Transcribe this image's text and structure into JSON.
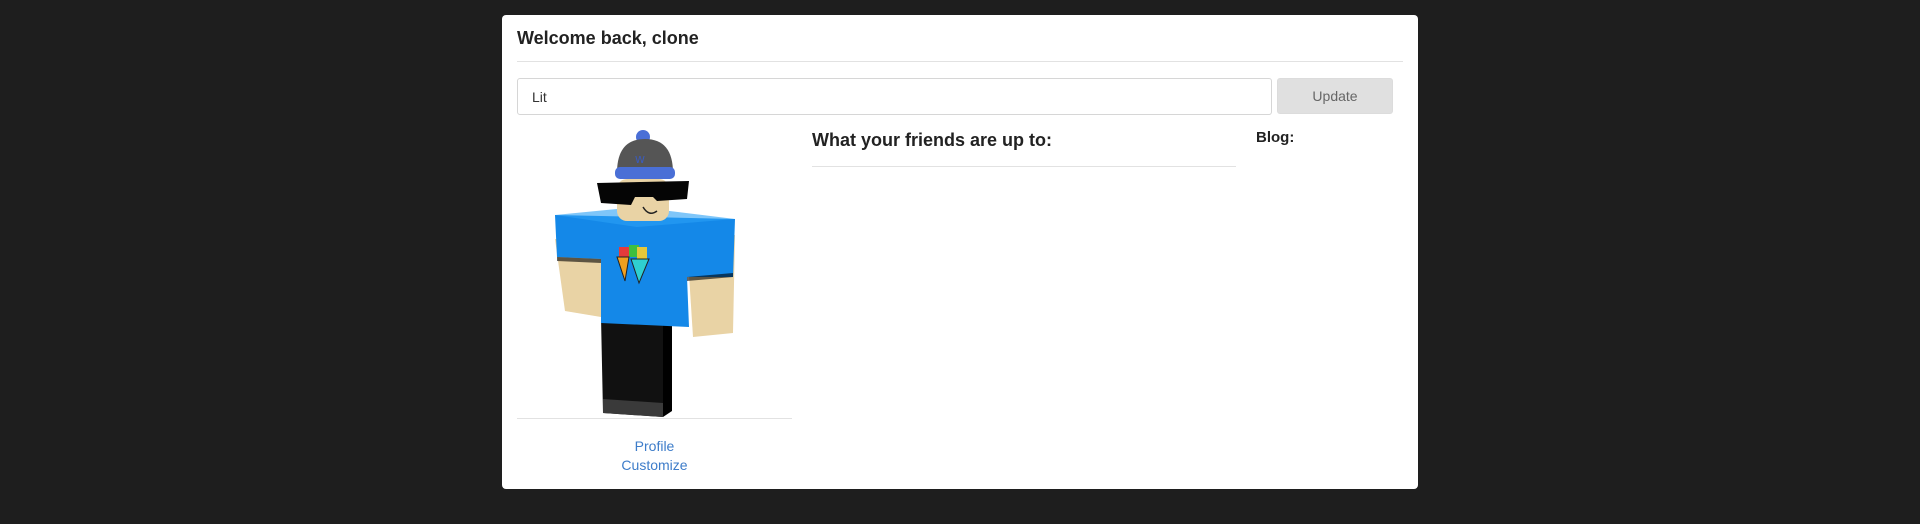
{
  "dashboard": {
    "welcome_title": "Welcome back, clone",
    "status": {
      "value": "Lit",
      "placeholder": ""
    },
    "update_label": "Update"
  },
  "avatar": {
    "icon": "avatar-character-icon",
    "links": {
      "profile": "Profile",
      "customize": "Customize"
    }
  },
  "feed": {
    "title": "What your friends are up to:"
  },
  "blog": {
    "label": "Blog:"
  },
  "colors": {
    "page_background": "#1e1e1e",
    "card_background": "#ffffff",
    "link": "#3d7cc9",
    "button_background": "#e0e0e0"
  }
}
